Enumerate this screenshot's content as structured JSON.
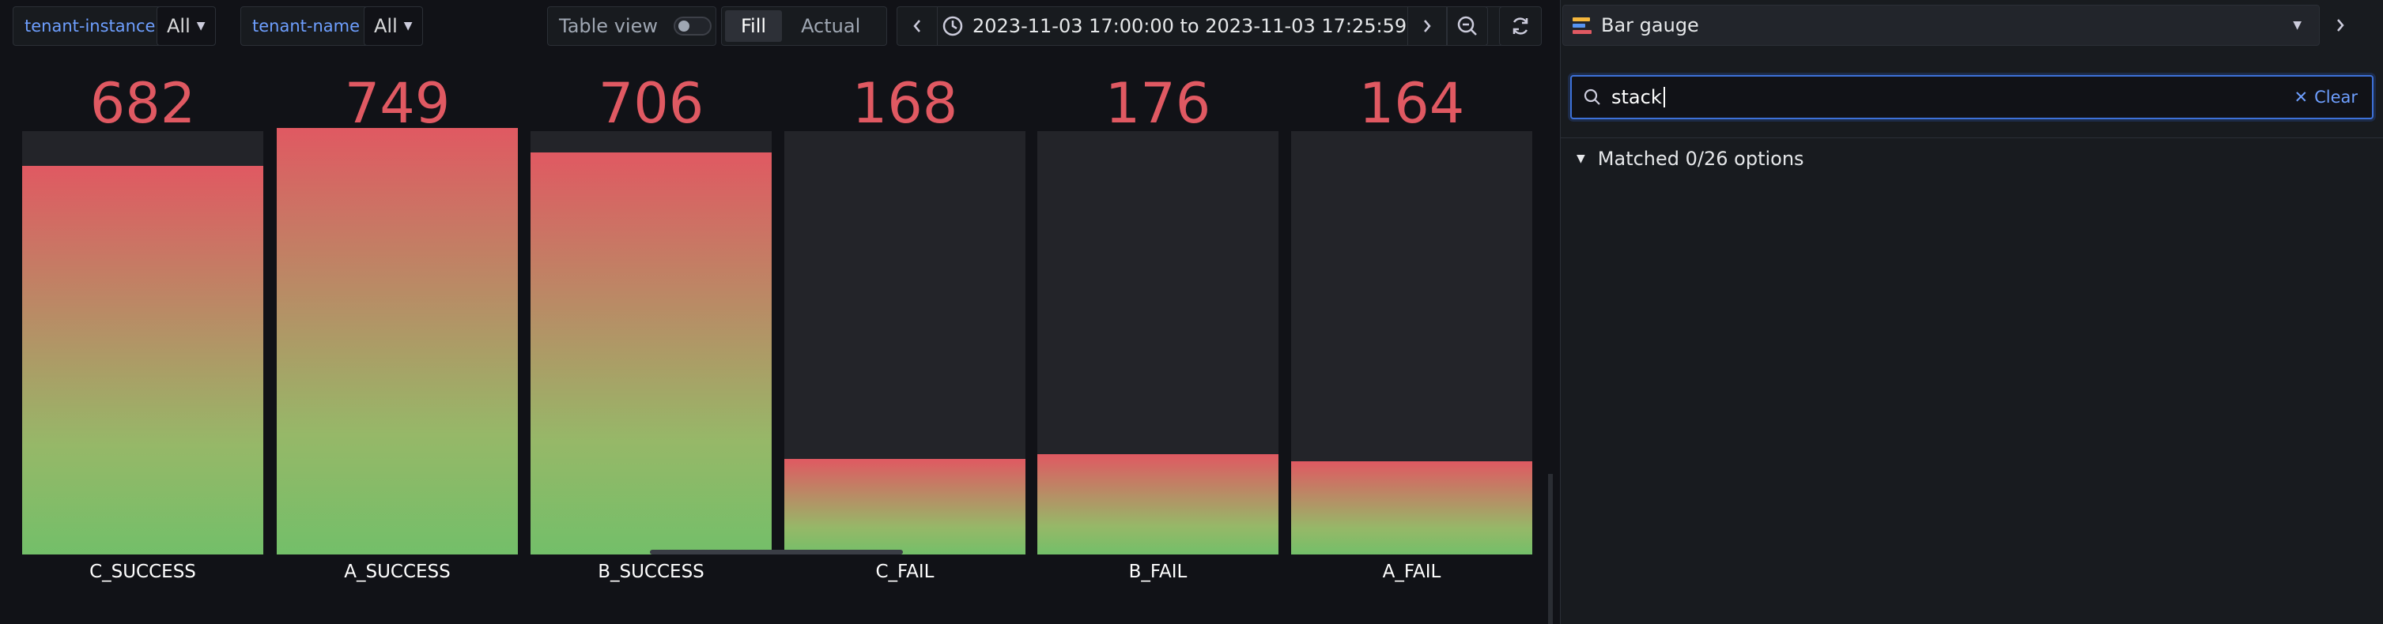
{
  "variables": [
    {
      "label": "tenant-instance",
      "value": "All"
    },
    {
      "label": "tenant-name",
      "value": "All"
    }
  ],
  "table_view_label": "Table view",
  "table_view_on": false,
  "fill_mode": {
    "options": [
      "Fill",
      "Actual"
    ],
    "selected": "Fill"
  },
  "time_range": "2023-11-03 17:00:00 to 2023-11-03 17:25:59",
  "visualization": "Bar gauge",
  "search": {
    "value": "stack",
    "clear_label": "Clear"
  },
  "matched_text": "Matched 0/26 options",
  "icons": {
    "clock": "clock-icon",
    "zoom_out": "zoom-out-icon",
    "refresh": "refresh-icon",
    "search": "search-icon"
  },
  "colors": {
    "gradient_top": "#e05962",
    "gradient_bottom": "#73bf69",
    "value_text": "#e05962",
    "accent": "#6e9fff"
  },
  "gauge": {
    "max": 749
  },
  "bars": [
    {
      "name": "C_SUCCESS",
      "value": 682
    },
    {
      "name": "A_SUCCESS",
      "value": 749
    },
    {
      "name": "B_SUCCESS",
      "value": 706
    },
    {
      "name": "C_FAIL",
      "value": 168
    },
    {
      "name": "B_FAIL",
      "value": 176
    },
    {
      "name": "A_FAIL",
      "value": 164
    }
  ]
}
